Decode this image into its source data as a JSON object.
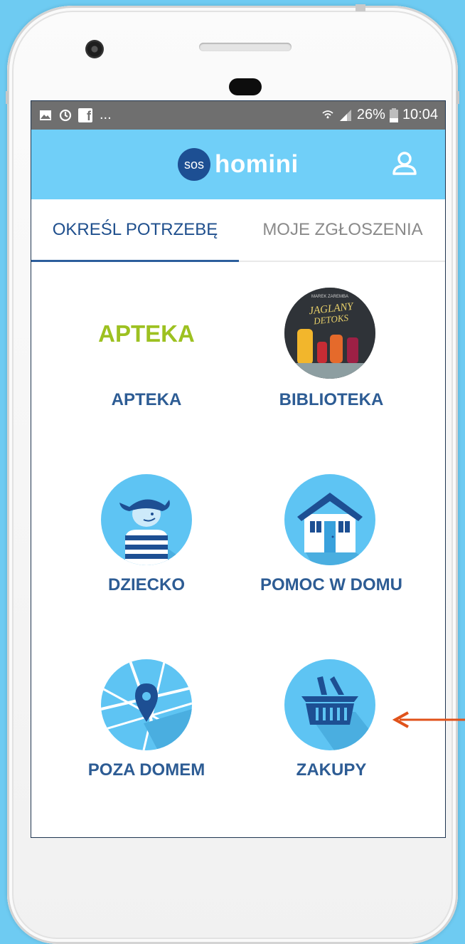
{
  "statusbar": {
    "left_icons": [
      "image-icon",
      "sync-icon",
      "facebook-icon"
    ],
    "facebook_glyph": "f",
    "ellipsis": "...",
    "battery": "26%",
    "time": "10:04"
  },
  "appbar": {
    "logo_badge": "sos",
    "logo_text": "homini"
  },
  "tabs": [
    {
      "label": "OKREŚL POTRZEBĘ"
    },
    {
      "label": "MOJE ZGŁOSZENIA"
    }
  ],
  "categories": [
    {
      "label": "APTEKA",
      "logo_text": "APTEKA",
      "icon": "pharmacy-logo"
    },
    {
      "label": "BIBLIOTEKA",
      "icon": "book-cover-icon",
      "cover_title": "JAGLANY DETOKS",
      "cover_author": "MAREK ZAREMBA"
    },
    {
      "label": "DZIECKO",
      "icon": "child-icon"
    },
    {
      "label": "POMOC W DOMU",
      "icon": "house-icon"
    },
    {
      "label": "POZA DOMEM",
      "icon": "map-pin-icon"
    },
    {
      "label": "ZAKUPY",
      "icon": "shopping-basket-icon"
    }
  ],
  "colors": {
    "background": "#6ecbf2",
    "appbar": "#70cff8",
    "logo_badge": "#1d4f93",
    "label": "#2d5c94",
    "tab_active": "#1f4f8d",
    "tab_inactive": "#8a8a8a",
    "apteka_green": "#9dc121",
    "annotation_arrow": "#e0521a"
  }
}
